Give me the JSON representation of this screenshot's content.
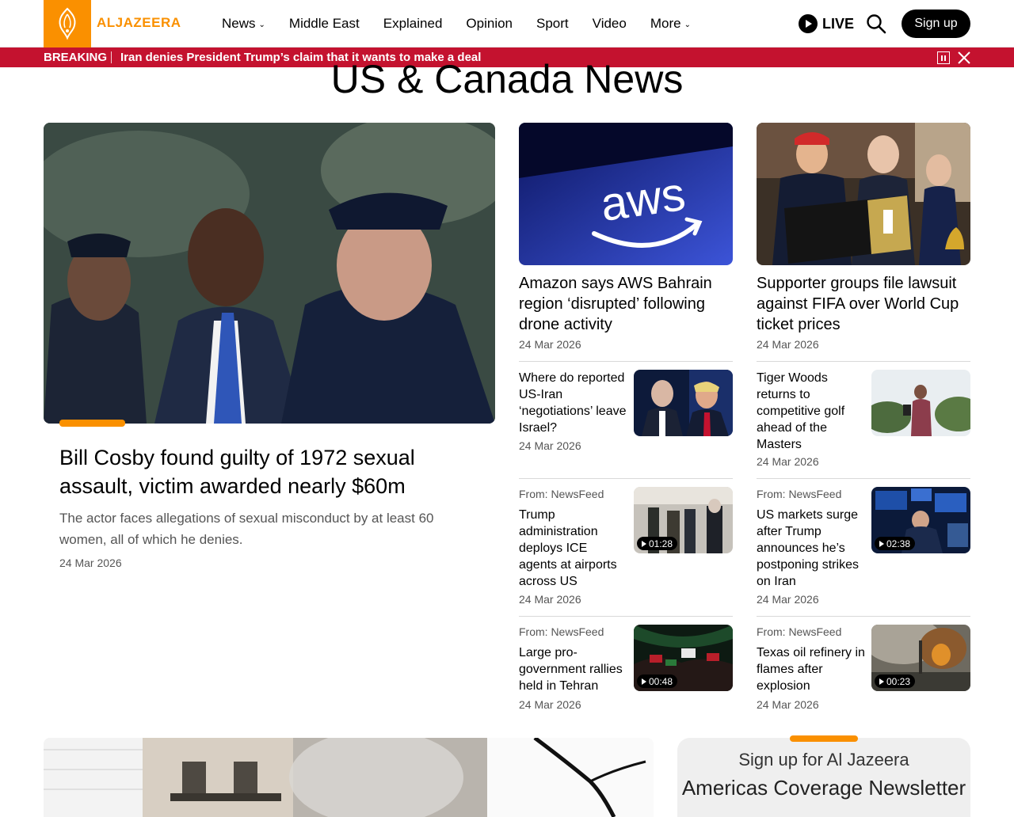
{
  "header": {
    "logo_text": "ALJAZEERA",
    "nav": [
      {
        "label": "News",
        "has_menu": true
      },
      {
        "label": "Middle East",
        "has_menu": false
      },
      {
        "label": "Explained",
        "has_menu": false
      },
      {
        "label": "Opinion",
        "has_menu": false
      },
      {
        "label": "Sport",
        "has_menu": false
      },
      {
        "label": "Video",
        "has_menu": false
      },
      {
        "label": "More",
        "has_menu": true
      }
    ],
    "live_label": "LIVE",
    "signup_label": "Sign up"
  },
  "breaking": {
    "label": "BREAKING",
    "message": "Iran denies President Trump’s claim that it wants to make a deal"
  },
  "page_title": "US & Canada News",
  "feature": {
    "title": "Bill Cosby found guilty of 1972 sexual assault, victim awarded nearly $60m",
    "summary": "The actor faces allegations of sexual misconduct by at least 60 women, all of which he denies.",
    "date": "24 Mar 2026"
  },
  "column1": {
    "top": {
      "title": "Amazon says AWS Bahrain region ‘disrupted’ following drone activity",
      "date": "24 Mar 2026"
    },
    "items": [
      {
        "from": "",
        "title": "Where do reported US-Iran ‘negotiations’ leave Israel?",
        "date": "24 Mar 2026",
        "duration": ""
      },
      {
        "from": "From: NewsFeed",
        "title": "Trump administration deploys ICE agents at airports across US",
        "date": "24 Mar 2026",
        "duration": "01:28"
      },
      {
        "from": "From: NewsFeed",
        "title": "Large pro-government rallies held in Tehran",
        "date": "24 Mar 2026",
        "duration": "00:48"
      }
    ]
  },
  "column2": {
    "top": {
      "title": "Supporter groups file lawsuit against FIFA over World Cup ticket prices",
      "date": "24 Mar 2026"
    },
    "items": [
      {
        "from": "",
        "title": "Tiger Woods returns to competitive golf ahead of the Masters",
        "date": "24 Mar 2026",
        "duration": ""
      },
      {
        "from": "From: NewsFeed",
        "title": "US markets surge after Trump announces he’s postponing strikes on Iran",
        "date": "24 Mar 2026",
        "duration": "02:38"
      },
      {
        "from": "From: NewsFeed",
        "title": "Texas oil refinery in flames after explosion",
        "date": "24 Mar 2026",
        "duration": "00:23"
      }
    ]
  },
  "newsletter": {
    "subtitle": "Sign up for Al Jazeera",
    "title": "Americas Coverage Newsletter"
  },
  "colors": {
    "brand": "#fa9000",
    "breaking": "#c4122f"
  }
}
